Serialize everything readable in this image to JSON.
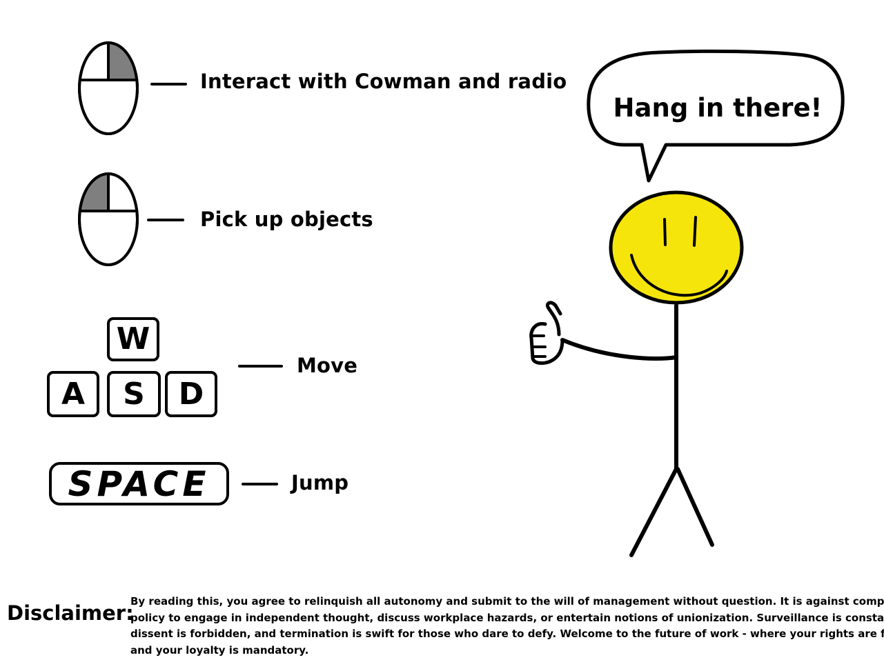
{
  "controls": {
    "interact": {
      "label": "Interact with Cowman and radio",
      "mouse_button": "right"
    },
    "pickup": {
      "label": "Pick up objects",
      "mouse_button": "left"
    },
    "move": {
      "label": "Move",
      "keys": [
        "W",
        "A",
        "S",
        "D"
      ]
    },
    "jump": {
      "label": "Jump",
      "key": "SPACE"
    }
  },
  "character": {
    "speech": "Hang in there!",
    "face_color": "#f6e50a",
    "highlight_color": "#7f7f7f"
  },
  "disclaimer": {
    "title": "Disclaimer:",
    "lines": [
      "By reading this, you agree to relinquish all autonomy and submit to the will of management without question. It is against company",
      "policy to engage in independent thought, discuss workplace hazards, or entertain notions of unionization. Surveillance is constant,",
      "dissent is forbidden, and termination is swift for those who dare to defy. Welcome to the future of work - where your rights are forfeit,",
      "and your loyalty is mandatory."
    ]
  }
}
